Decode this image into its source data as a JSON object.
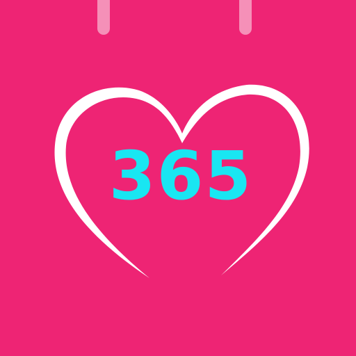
{
  "icon": {
    "count_text": "365",
    "background_color": "#ee2474",
    "ring_color": "#f6a3c4",
    "heart_color": "#ffffff",
    "count_color": "#19e6f2",
    "heart_icon": "heart-outline-icon",
    "ring_icon": "calendar-ring-icon"
  }
}
